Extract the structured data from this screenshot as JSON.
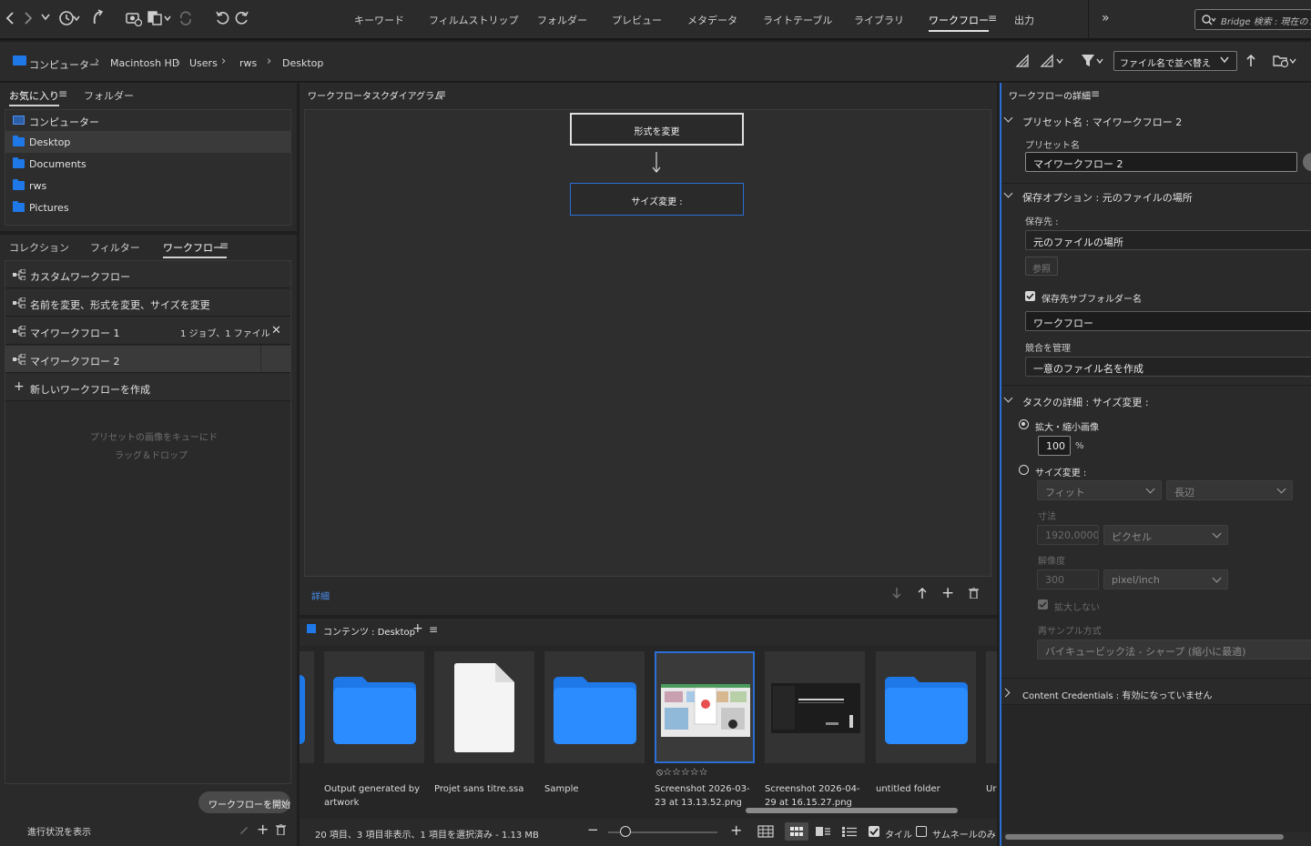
{
  "topbar": {
    "nav": [
      "キーワード",
      "フィルムストリップ",
      "フォルダー",
      "プレビュー",
      "メタデータ",
      "ライトテーブル",
      "ライブラリ",
      "ワークフロー",
      "出力"
    ],
    "active_nav": "ワークフロー",
    "search_placeholder": "Bridge 検索 : 現在のフ..."
  },
  "breadcrumb": [
    "コンピューター",
    "Macintosh HD",
    "Users",
    "rws",
    "Desktop"
  ],
  "sort_label": "ファイル名で並べ替え",
  "favorites_panel": {
    "tabs": [
      "お気に入り",
      "フォルダー"
    ],
    "items": [
      "コンピューター",
      "Desktop",
      "Documents",
      "rws",
      "Pictures"
    ]
  },
  "workflow_panel": {
    "tabs": [
      "コレクション",
      "フィルター",
      "ワークフロー"
    ],
    "items": [
      "カスタムワークフロー",
      "名前を変更、形式を変更、サイズを変更",
      "マイワークフロー 1",
      "マイワークフロー 2"
    ],
    "item1_status": "1 ジョブ、1 ファイル",
    "new_label": "新しいワークフローを作成",
    "drop_hint_line1": "プリセットの画像をキューにド",
    "drop_hint_line2": "ラッグ＆ドロップ",
    "start_button": "ワークフローを開始",
    "progress_label": "進行状況を表示"
  },
  "diagram_panel": {
    "title": "ワークフロータスクダイアグラム",
    "step1": "形式を変更",
    "step2": "サイズ変更 :",
    "details_link": "詳細"
  },
  "content_panel": {
    "title": "コンテンツ : Desktop",
    "items": [
      {
        "name": "Output generated by artwork",
        "kind": "folder"
      },
      {
        "name": "Projet sans titre.ssa",
        "kind": "file"
      },
      {
        "name": "Sample",
        "kind": "folder"
      },
      {
        "name": "Screenshot 2026-03-23 at 13.13.52.png",
        "kind": "image-light"
      },
      {
        "name": "Screenshot 2026-04-29 at 16.15.27.png",
        "kind": "image-dark"
      },
      {
        "name": "untitled folder",
        "kind": "folder"
      },
      {
        "name": "Ur",
        "kind": "partial"
      }
    ],
    "rating": "⦸☆☆☆☆☆",
    "status": "20 項目、3 項目非表示、1 項目を選択済み - 1.13 MB",
    "tile_label": "タイル",
    "thumbs_only_label": "サムネールのみ"
  },
  "details_panel": {
    "title": "ワークフローの詳細",
    "preset_section": "プリセット名 : マイワークフロー 2",
    "preset_label": "プリセット名",
    "preset_value": "マイワークフロー 2",
    "save_section": "保存オプション : 元のファイルの場所",
    "save_to_label": "保存先 :",
    "save_to_value": "元のファイルの場所",
    "browse_button": "参照",
    "subfolder_label": "保存先サブフォルダー名",
    "subfolder_value": "ワークフロー",
    "conflict_label": "競合を管理",
    "conflict_value": "一意のファイル名を作成",
    "task_section": "タスクの詳細 : サイズ変更 :",
    "scale_label": "拡大・縮小画像",
    "scale_value": "100",
    "scale_unit": "%",
    "resize_label": "サイズ変更 :",
    "fit_value": "フィット",
    "edge_value": "長辺",
    "dimension_label": "寸法",
    "dimension_value": "1920,0000",
    "dimension_unit": "ピクセル",
    "resolution_label": "解像度",
    "resolution_value": "300",
    "resolution_unit": "pixel/inch",
    "no_enlarge_label": "拡大しない",
    "resample_label": "再サンプル方式",
    "resample_value": "バイキュービック法 - シャープ (縮小に最適)",
    "credentials_section": "Content Credentials : 有効になっていません"
  }
}
